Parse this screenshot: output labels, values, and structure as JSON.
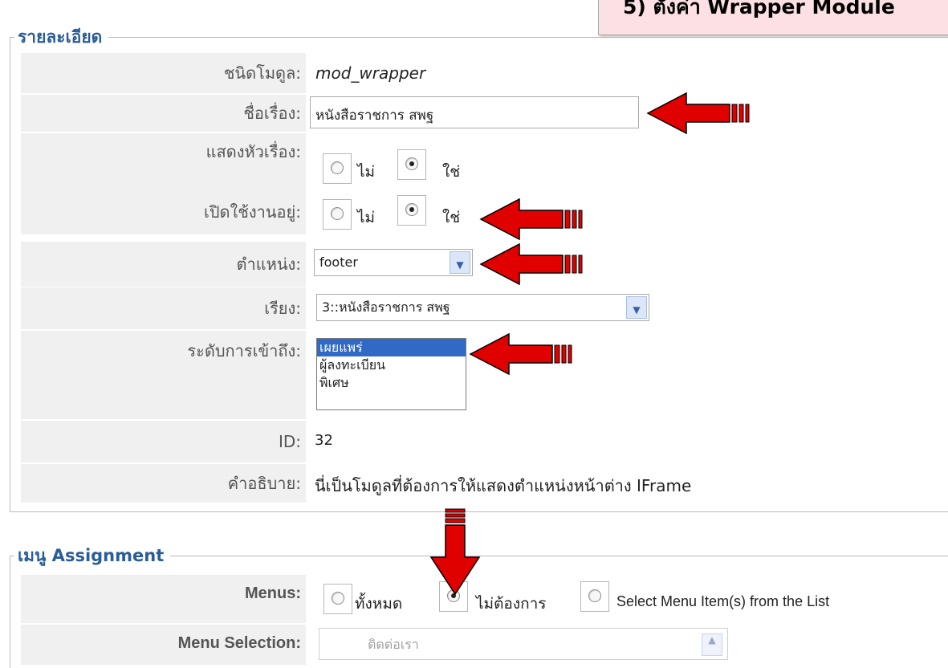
{
  "callout": {
    "title": "5) ตั้งค่า Wrapper Module"
  },
  "details": {
    "legend": "รายละเอียด",
    "module_type": {
      "label": "ชนิดโมดูล:",
      "value": "mod_wrapper"
    },
    "title": {
      "label": "ชื่อเรื่อง:",
      "value": "หนังสือราชการ สพฐ"
    },
    "show_title": {
      "label": "แสดงหัวเรื่อง:",
      "no": "ไม่",
      "yes": "ใช่",
      "selected": "ใช่"
    },
    "enabled": {
      "label": "เปิดใช้งานอยู่:",
      "no": "ไม่",
      "yes": "ใช่",
      "selected": "ใช่"
    },
    "position": {
      "label": "ตำแหน่ง:",
      "value": "footer"
    },
    "order": {
      "label": "เรียง:",
      "value": "3::หนังสือราชการ สพฐ"
    },
    "access": {
      "label": "ระดับการเข้าถึง:",
      "options": [
        "เผยแพร่",
        "ผู้ลงทะเบียน",
        "พิเศษ"
      ],
      "selected": "เผยแพร่"
    },
    "id": {
      "label": "ID:",
      "value": "32"
    },
    "description": {
      "label": "คำอธิบาย:",
      "value": "นี่เป็นโมดูลที่ต้องการให้แสดงตำแหน่งหน้าต่าง IFrame"
    }
  },
  "menu_assignment": {
    "legend": "เมนู Assignment",
    "menus": {
      "label": "Menus:",
      "all": "ทั้งหมด",
      "none": "ไม่ต้องการ",
      "select": "Select Menu Item(s) from the List",
      "selected": "ไม่ต้องการ"
    },
    "menu_selection": {
      "label": "Menu Selection:",
      "value": "ติดต่อเรา"
    }
  },
  "colors": {
    "legend": "#2a5c9a",
    "callout_bg": "#fde0e3",
    "arrow": "#e00000",
    "selection": "#3169c6"
  }
}
